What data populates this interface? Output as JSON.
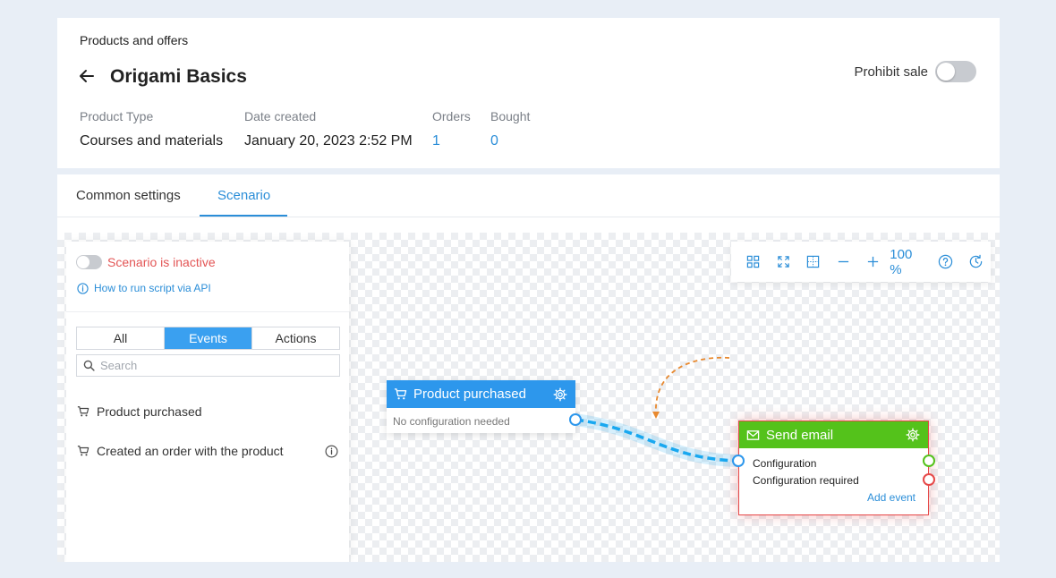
{
  "breadcrumb": "Products and offers",
  "title": "Origami Basics",
  "prohibit_sale": {
    "label": "Prohibit sale",
    "on": false
  },
  "meta": {
    "product_type": {
      "label": "Product Type",
      "value": "Courses and materials"
    },
    "date_created": {
      "label": "Date created",
      "value": "January 20, 2023 2:52 PM"
    },
    "orders": {
      "label": "Orders",
      "value": "1"
    },
    "bought": {
      "label": "Bought",
      "value": "0"
    }
  },
  "tabs": [
    {
      "label": "Common settings",
      "active": false
    },
    {
      "label": "Scenario",
      "active": true
    }
  ],
  "panel": {
    "status": "Scenario is inactive",
    "api_link": "How to run script via API",
    "filters": [
      "All",
      "Events",
      "Actions"
    ],
    "active_filter": "Events",
    "search_placeholder": "Search",
    "events": [
      "Product purchased",
      "Created an order with the product"
    ]
  },
  "toolbar": {
    "zoom": "100 %",
    "icons": [
      "grid-icon",
      "fit-screen-icon",
      "select-area-icon",
      "zoom-out-icon",
      "zoom-in-icon",
      "help-icon",
      "history-icon"
    ]
  },
  "nodes": {
    "trigger": {
      "title": "Product purchased",
      "subtitle": "No configuration needed",
      "color": "#2d97ec"
    },
    "action": {
      "title": "Send email",
      "line1": "Configuration",
      "line2": "Configuration required",
      "add_event": "Add event",
      "color": "#54c21b"
    }
  },
  "colors": {
    "accent": "#2b8ed8",
    "error": "#e35656",
    "success": "#54c21b",
    "wire": "#19a8f0",
    "drag_arrow": "#e8892f"
  }
}
